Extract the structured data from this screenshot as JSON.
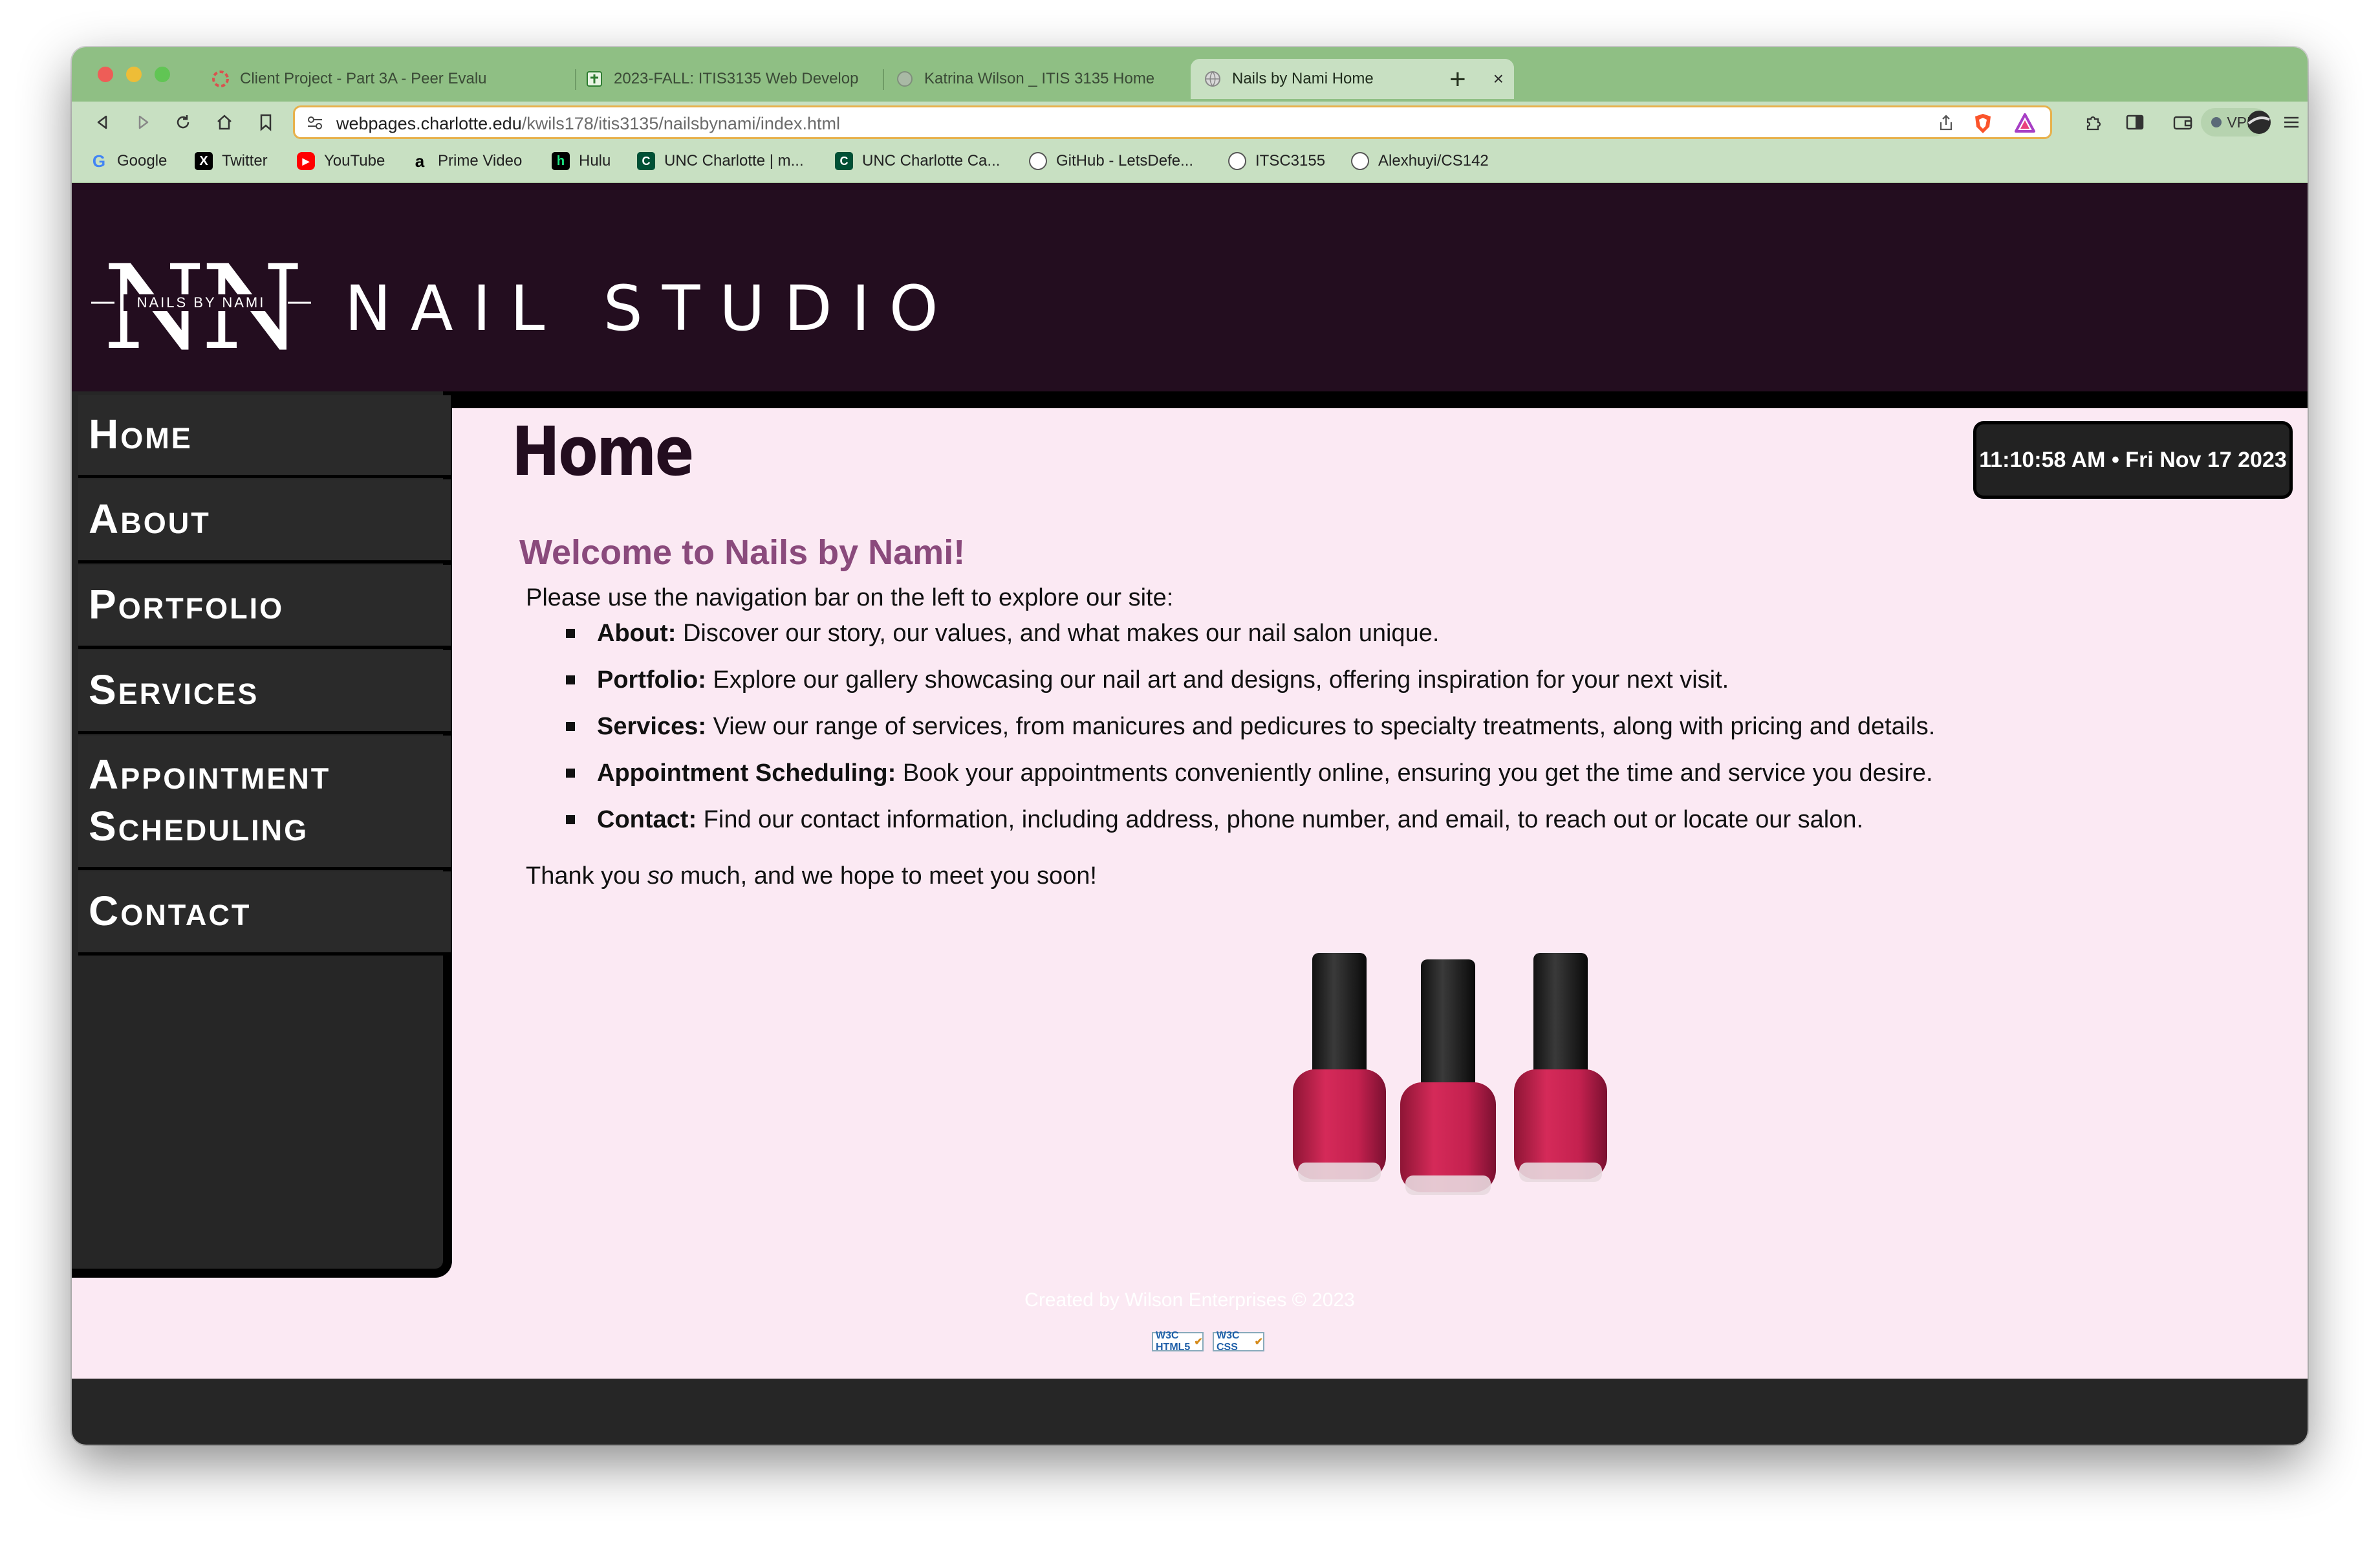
{
  "browser": {
    "tabs": [
      {
        "title": "Client Project - Part 3A - Peer Evalu",
        "active": false,
        "favicon": "spinner-icon"
      },
      {
        "title": "2023-FALL: ITIS3135 Web Develop",
        "active": false,
        "favicon": "doc-icon"
      },
      {
        "title": "Katrina Wilson _ ITIS 3135 Home",
        "active": false,
        "favicon": "globe-icon"
      },
      {
        "title": "Nails by Nami Home",
        "active": true,
        "favicon": "globe-icon"
      }
    ],
    "new_tab": "+",
    "close_tab": "×",
    "url_host": "webpages.charlotte.edu",
    "url_path": "/kwils178/itis3135/nailsbynami/index.html",
    "vpn_label": "VPN",
    "bookmarks": [
      {
        "label": "Google",
        "icon": "google-icon",
        "color": "#4285f4"
      },
      {
        "label": "Twitter",
        "icon": "x-icon",
        "color": "#000000"
      },
      {
        "label": "YouTube",
        "icon": "youtube-icon",
        "color": "#ff0000"
      },
      {
        "label": "Prime Video",
        "icon": "amazon-icon",
        "color": "#000000"
      },
      {
        "label": "Hulu",
        "icon": "hulu-icon",
        "color": "#1ce783"
      },
      {
        "label": "UNC Charlotte | m...",
        "icon": "unc-icon",
        "color": "#005035"
      },
      {
        "label": "UNC Charlotte Ca...",
        "icon": "unc-icon",
        "color": "#005035"
      },
      {
        "label": "GitHub - LetsDefe...",
        "icon": "github-icon",
        "color": "#ffffff"
      },
      {
        "label": "ITSC3155",
        "icon": "github-icon",
        "color": "#ffffff"
      },
      {
        "label": "Alexhuyi/CS142",
        "icon": "github-icon",
        "color": "#ffffff"
      }
    ]
  },
  "site": {
    "logo_text": "NAILS BY NAMI",
    "logo_letters": "NN",
    "title": "NAIL STUDIO",
    "nav": [
      "Home",
      "About",
      "Portfolio",
      "Services",
      "Appointment Scheduling",
      "Contact"
    ],
    "heading": "Home",
    "welcome": "Welcome to Nails by Nami!",
    "intro": "Please use the navigation bar on the left to explore our site:",
    "items": [
      {
        "term": "About:",
        "text": " Discover our story, our values, and what makes our nail salon unique."
      },
      {
        "term": "Portfolio:",
        "text": " Explore our gallery showcasing our nail art and designs, offering inspiration for your next visit."
      },
      {
        "term": "Services:",
        "text": " View our range of services, from manicures and pedicures to specialty treatments, along with pricing and details."
      },
      {
        "term": "Appointment Scheduling:",
        "text": " Book your appointments conveniently online, ensuring you get the time and service you desire."
      },
      {
        "term": "Contact:",
        "text": " Find our contact information, including address, phone number, and email, to reach out or locate our salon."
      }
    ],
    "thanks_pre": "Thank you ",
    "thanks_em": "so",
    "thanks_post": " much, and we hope to meet you soon!",
    "clock": "11:10:58 AM • Fri Nov 17 2023",
    "footer": "Created by Wilson Enterprises © 2023",
    "badge_html": "W3C HTML5",
    "badge_css": "W3C CSS"
  },
  "colors": {
    "header_bg": "#230d1f",
    "page_bg": "#fbe9f3",
    "welcome": "#8a4a7c",
    "sidebar": "#262626",
    "polish": "#c4214f"
  }
}
